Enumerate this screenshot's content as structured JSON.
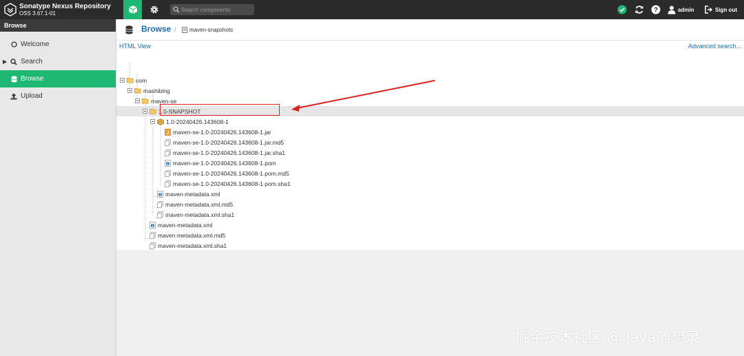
{
  "app": {
    "title": "Sonatype Nexus Repository",
    "version": "OSS 3.67.1-01"
  },
  "topbar": {
    "search_placeholder": "Search components",
    "username": "admin",
    "signout_label": "Sign out",
    "colors": {
      "background": "#2b2b2b",
      "accent": "#1fb872"
    }
  },
  "sidebar": {
    "header": "Browse",
    "items": [
      {
        "label": "Welcome",
        "icon": "circle-icon"
      },
      {
        "label": "Search",
        "icon": "search-icon"
      },
      {
        "label": "Browse",
        "icon": "database-icon",
        "active": true
      },
      {
        "label": "Upload",
        "icon": "upload-icon"
      }
    ]
  },
  "breadcrumb": {
    "title": "Browse",
    "separator": "/",
    "repository": "maven-snapshots"
  },
  "panel": {
    "html_view": "HTML View",
    "advanced_search": "Advanced search..."
  },
  "tree": [
    {
      "label": "com",
      "type": "folder"
    },
    {
      "label": "mashibing",
      "type": "folder"
    },
    {
      "label": "maven-se",
      "type": "folder"
    },
    {
      "label": "1.0-SNAPSHOT",
      "type": "folder",
      "selected": true
    },
    {
      "label": "1.0-20240426.143608-1",
      "type": "component"
    },
    {
      "label": "maven-se-1.0-20240426.143608-1.jar",
      "type": "jar",
      "highlighted": true
    },
    {
      "label": "maven-se-1.0-20240426.143608-1.jar.md5",
      "type": "file"
    },
    {
      "label": "maven-se-1.0-20240426.143608-1.jar.sha1",
      "type": "file"
    },
    {
      "label": "maven-se-1.0-20240426.143608-1.pom",
      "type": "pom"
    },
    {
      "label": "maven-se-1.0-20240426.143608-1.pom.md5",
      "type": "file"
    },
    {
      "label": "maven-se-1.0-20240426.143608-1.pom.sha1",
      "type": "file"
    },
    {
      "label": "maven-metadata.xml",
      "type": "xml"
    },
    {
      "label": "maven-metadata.xml.md5",
      "type": "file"
    },
    {
      "label": "maven-metadata.xml.sha1",
      "type": "file"
    },
    {
      "label": "maven-metadata.xml",
      "type": "xml"
    },
    {
      "label": "maven-metadata.xml.md5",
      "type": "file"
    },
    {
      "label": "maven-metadata.xml.sha1",
      "type": "file"
    }
  ],
  "annotation": {
    "color": "#e02020"
  },
  "watermark": "掘金技术社区 @ Java随想录"
}
